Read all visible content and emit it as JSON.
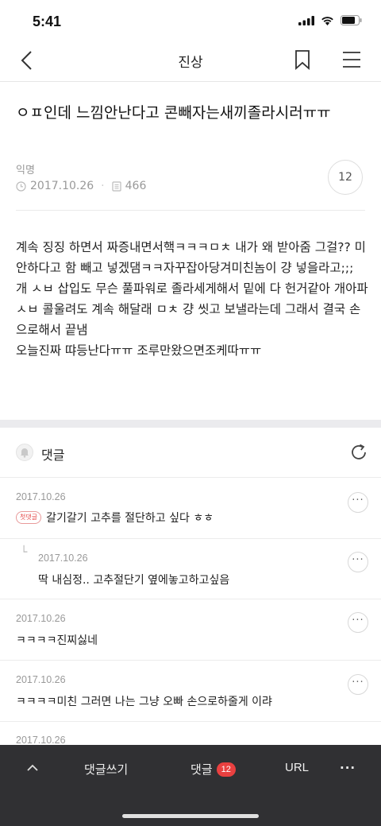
{
  "status_bar": {
    "time": "5:41"
  },
  "nav": {
    "title": "진상"
  },
  "post": {
    "title": "ㅇㅍ인데 느낌안난다고 콘빼자는새끼졸라시러ㅠㅠ",
    "author": "익명",
    "date": "2017.10.26",
    "views": "466",
    "comment_count": "12",
    "body": "계속 징징 하면서 짜증내면서핵ㅋㅋㅋㅁㅊ 내가 왜 받아줌 그걸?? 미안하다고 함 빼고 넣겠댐ㅋㅋ자꾸잡아당겨미친놈이 걍 넣을라고;;;\n개 ㅅㅂ 삽입도 무슨 풀파워로 졸라세게해서 밑에 다 헌거같아 개아파 ㅅㅂ 콜울려도 계속 해달래 ㅁㅊ 걍 씻고 보낼라는데 그래서 결국 손으로해서 끝냄\n오늘진짜 땨등난다ㅠㅠ 조루만왔으면조케따ㅠㅠ"
  },
  "comments_section": {
    "label": "댓글",
    "items": [
      {
        "date": "2017.10.26",
        "badge": "첫댓글",
        "text": "갈기갈기 고추를 절단하고 싶다 ㅎㅎ",
        "reply": false
      },
      {
        "date": "2017.10.26",
        "text": "딱 내심정.. 고추절단기 옆에놓고하고싶음",
        "reply": true
      },
      {
        "date": "2017.10.26",
        "text": "ㅋㅋㅋㅋ진찌싫네",
        "reply": false
      },
      {
        "date": "2017.10.26",
        "text": "ㅋㅋㅋㅋ미친 그러면 나는 그냥 오빠 손으로하줄게 이랴",
        "reply": false
      },
      {
        "date": "2017.10.26",
        "text": "",
        "reply": false
      }
    ],
    "more_label": "···"
  },
  "bottom_bar": {
    "write_label": "댓글쓰기",
    "comments_label": "댓글",
    "comments_count": "12",
    "url_label": "URL",
    "more_label": "···"
  },
  "colors": {
    "accent_red": "#e94040",
    "bottom_bar_bg": "#303033"
  }
}
